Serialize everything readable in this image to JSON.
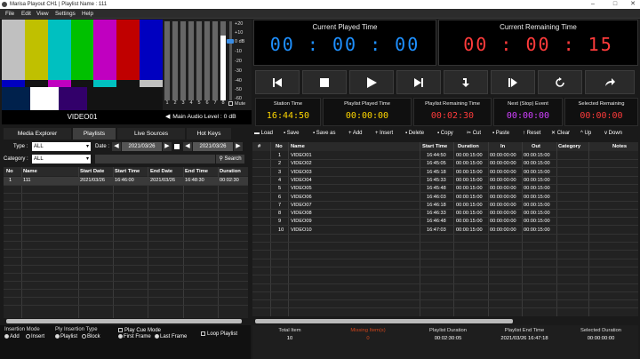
{
  "window": {
    "title": "Marisa Playout CH1 | Playlist Name : 111"
  },
  "menu": [
    "File",
    "Edit",
    "View",
    "Settings",
    "Help"
  ],
  "preview": {
    "clip_name": "VIDEO01"
  },
  "vu_meter": {
    "channels": [
      "1",
      "2",
      "3",
      "4",
      "5",
      "6",
      "7",
      "8"
    ],
    "levels": [
      0,
      0,
      0,
      0,
      0,
      0,
      0,
      0.82
    ],
    "db_scale": [
      "+20",
      "+10",
      "0 dB",
      "-10",
      "-20",
      "-30",
      "-40",
      "-50",
      "-60"
    ],
    "mute_label": "Mute",
    "main_audio_label": "Main Audio Level : 0 dB"
  },
  "clocks": {
    "current_played": {
      "label": "Current Played Time",
      "value": "00 : 00 : 00",
      "color": "#1e90ff"
    },
    "current_remaining": {
      "label": "Current Remaining Time",
      "value": "00 : 00 : 15",
      "color": "#ff3b3b"
    }
  },
  "transport": [
    "previous-icon",
    "stop-icon",
    "play-icon",
    "next-icon",
    "insert-icon",
    "pause-step-icon",
    "loop-icon",
    "skip-icon"
  ],
  "stats": [
    {
      "label": "Station Time",
      "value": "16:44:50",
      "color": "#ffd700"
    },
    {
      "label": "Playlist Played Time",
      "value": "00:00:00",
      "color": "#ffd700"
    },
    {
      "label": "Playlist Remaining Time",
      "value": "00:02:30",
      "color": "#ff3b3b"
    },
    {
      "label": "Next (Stop) Event",
      "value": "00:00:00",
      "color": "#d040ff"
    },
    {
      "label": "Selected Remaining",
      "value": "00:00:00",
      "color": "#ff3b3b"
    }
  ],
  "left": {
    "tabs": [
      "Media Explorer",
      "Playlists",
      "Live Sources",
      "Hot Keys"
    ],
    "active_tab": 1,
    "filter": {
      "type_label": "Type :",
      "type_value": "ALL",
      "category_label": "Category :",
      "category_value": "ALL",
      "date_label": "Date :",
      "date_from": "2021/03/26",
      "date_to": "2021/03/26",
      "search_label": "Search"
    },
    "columns": [
      "No",
      "Name",
      "Start Date",
      "Start Time",
      "End Date",
      "End Time",
      "Duration"
    ],
    "rows": [
      [
        "1",
        "111",
        "2021/03/26",
        "16:46:00",
        "2021/03/26",
        "16:48:30",
        "00:02:30"
      ]
    ]
  },
  "right": {
    "toolbar": [
      "Load",
      "Save",
      "Save as",
      "Add",
      "Insert",
      "Delete",
      "Copy",
      "Cut",
      "Paste",
      "Reset",
      "Clear",
      "Up",
      "Down"
    ],
    "columns": [
      "#",
      "No",
      "Name",
      "Start Time",
      "Duration",
      "In",
      "Out",
      "Category",
      "Notes"
    ],
    "rows": [
      [
        "1",
        "VIDEO01",
        "16:44:50",
        "00:00:15:00",
        "00:00:00:00",
        "00:00:15:00"
      ],
      [
        "2",
        "VIDEO02",
        "16:45:05",
        "00:00:15:00",
        "00:00:00:00",
        "00:00:15:00"
      ],
      [
        "3",
        "VIDEO03",
        "16:45:18",
        "00:00:15:00",
        "00:00:00:00",
        "00:00:15:00"
      ],
      [
        "4",
        "VIDEO04",
        "16:45:33",
        "00:00:15:00",
        "00:00:00:00",
        "00:00:15:00"
      ],
      [
        "5",
        "VIDEO05",
        "16:45:48",
        "00:00:15:00",
        "00:00:00:00",
        "00:00:15:00"
      ],
      [
        "6",
        "VIDEO06",
        "16:46:03",
        "00:00:15:00",
        "00:00:00:00",
        "00:00:15:00"
      ],
      [
        "7",
        "VIDEO07",
        "16:46:18",
        "00:00:15:00",
        "00:00:00:00",
        "00:00:15:00"
      ],
      [
        "8",
        "VIDEO08",
        "16:46:33",
        "00:00:15:00",
        "00:00:00:00",
        "00:00:15:00"
      ],
      [
        "9",
        "VIDEO09",
        "16:46:48",
        "00:00:15:00",
        "00:00:00:00",
        "00:00:15:00"
      ],
      [
        "10",
        "VIDEO10",
        "16:47:03",
        "00:00:15:00",
        "00:00:00:00",
        "00:00:15:00"
      ]
    ]
  },
  "bottom": {
    "insertion_mode_label": "Insertion Mode",
    "insertion_modes": [
      "Add",
      "Insert"
    ],
    "ply_insertion_label": "Ply Insertion Type",
    "ply_insertion_types": [
      "Playlist",
      "Block"
    ],
    "play_cue_label": "Play Cue Mode",
    "cue_modes": [
      "First Frame",
      "Last Frame"
    ],
    "loop_label": "Loop Playlist",
    "summary": [
      {
        "label": "Total Item",
        "value": "10"
      },
      {
        "label": "Missing Item(s)",
        "value": "0"
      },
      {
        "label": "Playlist Duration",
        "value": "00:02:30:05"
      },
      {
        "label": "Playlist End Time",
        "value": "2021/03/26  16:47:18"
      },
      {
        "label": "Selected Duration",
        "value": "00:00:00:00"
      }
    ]
  }
}
